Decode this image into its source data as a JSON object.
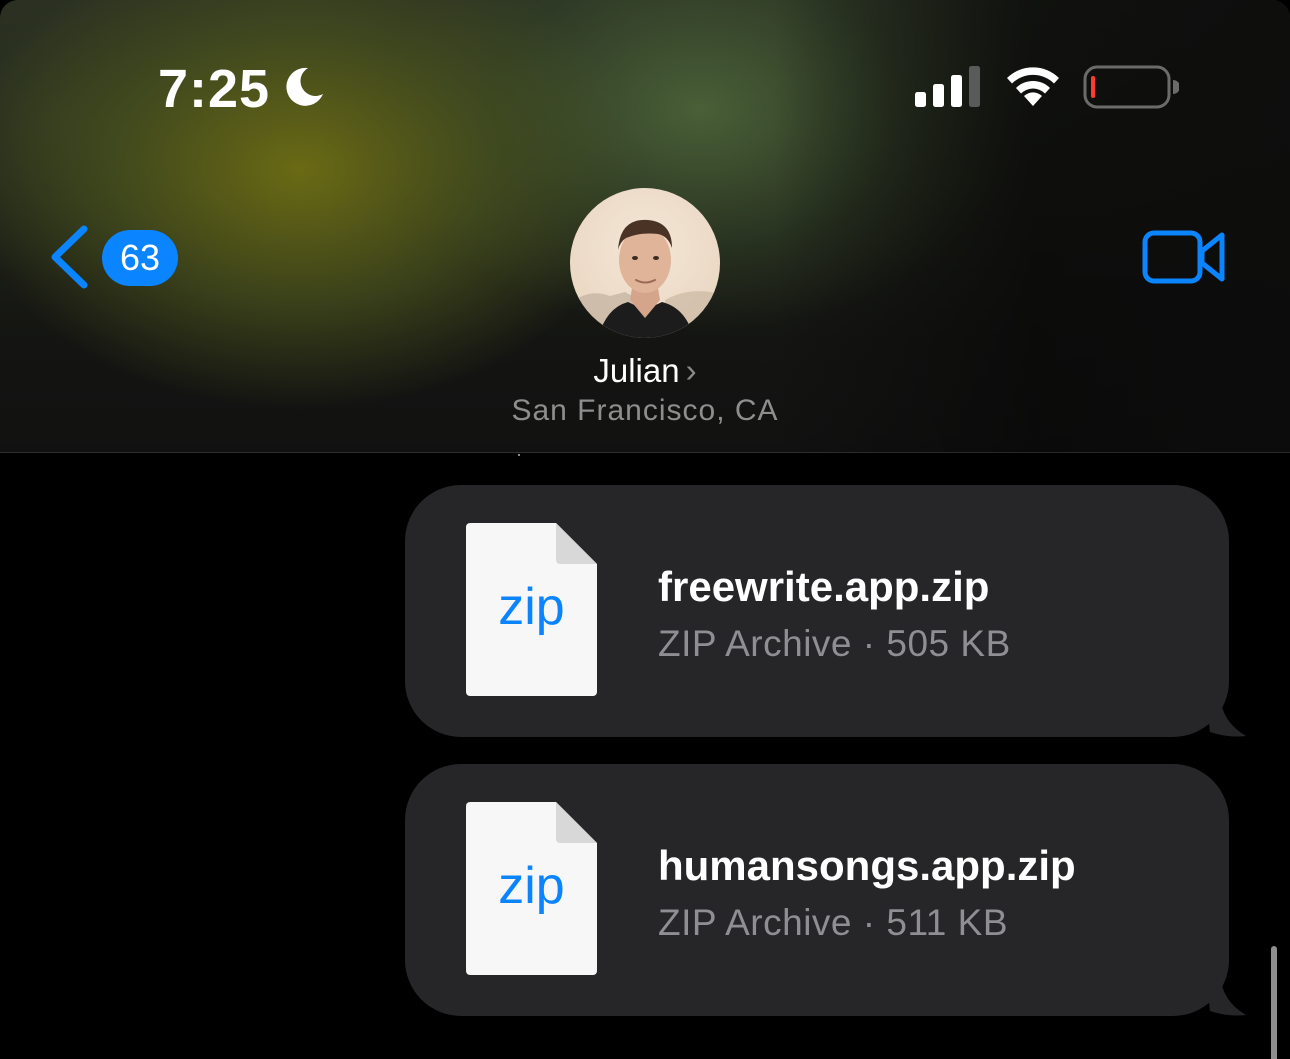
{
  "status_bar": {
    "time": "7:25",
    "focus_icon": "moon-icon",
    "signal_icon": "cellular-signal-icon",
    "wifi_icon": "wifi-icon",
    "battery_icon": "battery-low-icon",
    "battery_level": 0.05
  },
  "nav": {
    "back_icon": "chevron-left-icon",
    "unread_count": "63",
    "video_icon": "video-camera-icon"
  },
  "contact": {
    "name": "Julian",
    "name_chevron": "›",
    "location": "San Francisco, CA",
    "avatar_icon": "contact-photo"
  },
  "messages": [
    {
      "type": "attachment",
      "file_icon_label": "zip",
      "file_name": "freewrite.app.zip",
      "file_meta": "ZIP Archive · 505 KB"
    },
    {
      "type": "attachment",
      "file_icon_label": "zip",
      "file_name": "humansongs.app.zip",
      "file_meta": "ZIP Archive · 511 KB"
    }
  ],
  "colors": {
    "accent": "#0a84ff",
    "bubble": "#262628",
    "background": "#000000",
    "secondary_text": "#8e8e93",
    "battery_low": "#ff3b30"
  }
}
